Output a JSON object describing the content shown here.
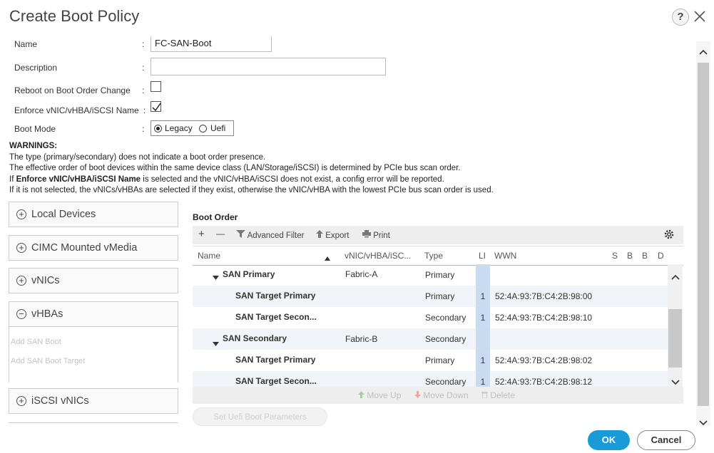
{
  "dialog": {
    "title": "Create Boot Policy",
    "help": "?"
  },
  "form": {
    "name_label": "Name",
    "name_value": "FC-SAN-Boot",
    "description_label": "Description",
    "description_value": "",
    "reboot_label": "Reboot on Boot Order Change",
    "reboot_checked": false,
    "enforce_label": "Enforce vNIC/vHBA/iSCSI Name",
    "enforce_checked": true,
    "boot_mode_label": "Boot Mode",
    "boot_mode_options": [
      "Legacy",
      "Uefi"
    ],
    "boot_mode_selected": "Legacy",
    "colon": ":"
  },
  "warnings": {
    "title": "WARNINGS:",
    "line1": "The type (primary/secondary) does not indicate a boot order presence.",
    "line2": "The effective order of boot devices within the same device class (LAN/Storage/iSCSI) is determined by PCIe bus scan order.",
    "line3_prefix": "If ",
    "line3_bold": "Enforce vNIC/vHBA/iSCSI Name",
    "line3_suffix": " is selected and the vNIC/vHBA/iSCSI does not exist, a config error will be reported.",
    "line4": "If it is not selected, the vNICs/vHBAs are selected if they exist, otherwise the vNIC/vHBA with the lowest PCIe bus scan order is used."
  },
  "devices": {
    "local": "Local Devices",
    "cimc": "CIMC Mounted vMedia",
    "vnics": "vNICs",
    "vhbas": "vHBAs",
    "add_san_boot": "Add SAN Boot",
    "add_san_boot_target": "Add SAN Boot Target",
    "iscsi": "iSCSI vNICs"
  },
  "boot_order": {
    "title": "Boot Order",
    "toolbar": {
      "add": "+",
      "remove": "—",
      "filter": "Advanced Filter",
      "export": "Export",
      "print": "Print"
    },
    "columns": {
      "name": "Name",
      "vnic": "vNIC/vHBA/iSC...",
      "type": "Type",
      "lun": "LI",
      "wwn": "WWN",
      "s": "S",
      "b": "B",
      "b2": "B",
      "d": "D"
    },
    "rows": [
      {
        "name": "SAN Primary",
        "vnic": "Fabric-A",
        "type": "Primary",
        "lun": "",
        "wwn": ""
      },
      {
        "name": "SAN Target Primary",
        "vnic": "",
        "type": "Primary",
        "lun": "1",
        "wwn": "52:4A:93:7B:C4:2B:98:00"
      },
      {
        "name": "SAN Target Secon...",
        "vnic": "",
        "type": "Secondary",
        "lun": "1",
        "wwn": "52:4A:93:7B:C4:2B:98:10"
      },
      {
        "name": "SAN Secondary",
        "vnic": "Fabric-B",
        "type": "Secondary",
        "lun": "",
        "wwn": ""
      },
      {
        "name": "SAN Target Primary",
        "vnic": "",
        "type": "Primary",
        "lun": "1",
        "wwn": "52:4A:93:7B:C4:2B:98:02"
      },
      {
        "name": "SAN Target Secon...",
        "vnic": "",
        "type": "Secondary",
        "lun": "1",
        "wwn": "52:4A:93:7B:C4:2B:98:12"
      }
    ],
    "actions": {
      "move_up": "Move Up",
      "move_down": "Move Down",
      "delete": "Delete"
    },
    "uefi_button": "Set Uefi Boot Parameters"
  },
  "footer": {
    "ok": "OK",
    "cancel": "Cancel"
  },
  "colors": {
    "accent": "#1a9ad6",
    "lun_highlight": "#c9dbf0"
  }
}
